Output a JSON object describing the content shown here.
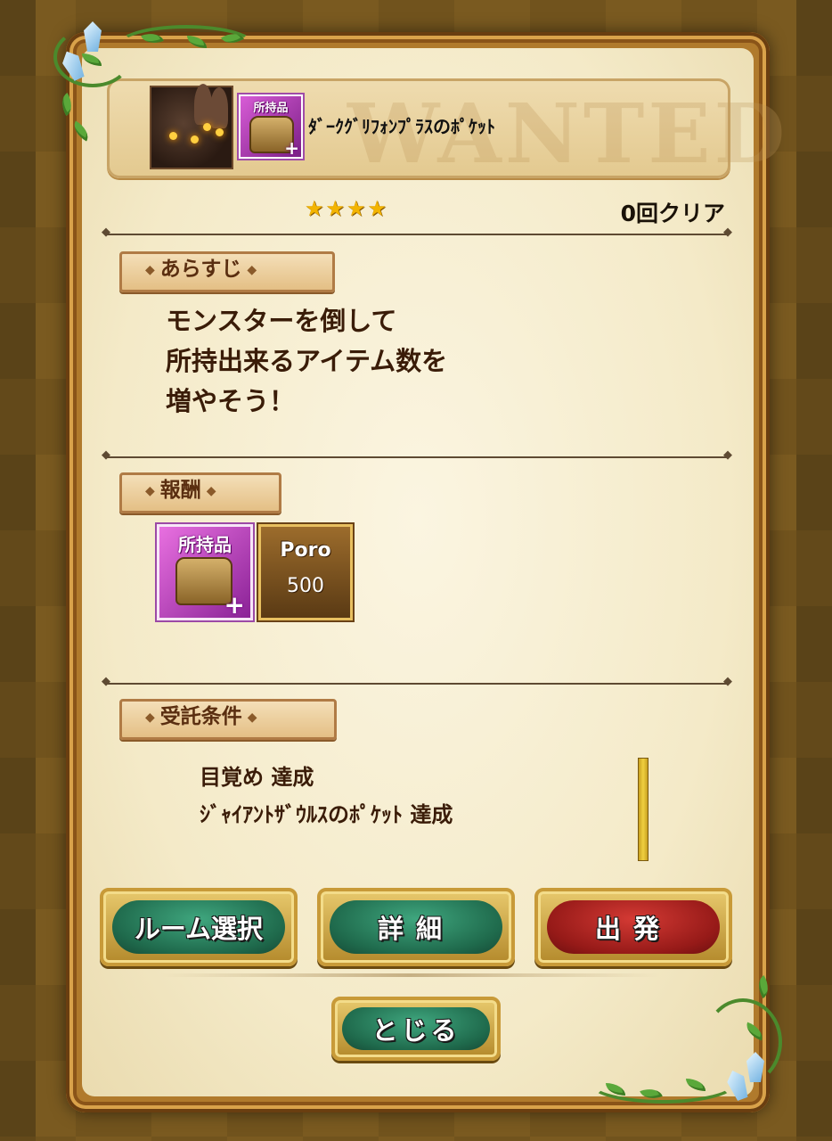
{
  "quest": {
    "bg_text": "WANTED",
    "title": "ﾀﾞｰｸｸﾞﾘﾌｫﾝﾌﾟﾗｽのﾎﾟｹｯﾄ",
    "item_thumb_label": "所持品",
    "stars": "★★★★",
    "clear_count": "0回クリア"
  },
  "sections": {
    "synopsis_label": "あらすじ",
    "reward_label": "報酬",
    "conditions_label": "受託条件",
    "decoration": "◆"
  },
  "synopsis": {
    "line1": "モンスターを倒して",
    "line2": "所持出来るアイテム数を",
    "line3": "増やそう！"
  },
  "rewards": {
    "item_label": "所持品",
    "plus": "+",
    "poro_label": "Poro",
    "poro_amount": "500"
  },
  "conditions": {
    "line1": "目覚め 達成",
    "line2": "ｼﾞｬｲｱﾝﾄｻﾞｳﾙｽのﾎﾟｹｯﾄ 達成"
  },
  "buttons": {
    "room_select": "ルーム選択",
    "details": "詳細",
    "depart": "出発",
    "close": "とじる"
  },
  "colors": {
    "button_green": "#1f6a4c",
    "button_red": "#961a18",
    "star": "#f3b400",
    "text_dark": "#3a1c08"
  }
}
